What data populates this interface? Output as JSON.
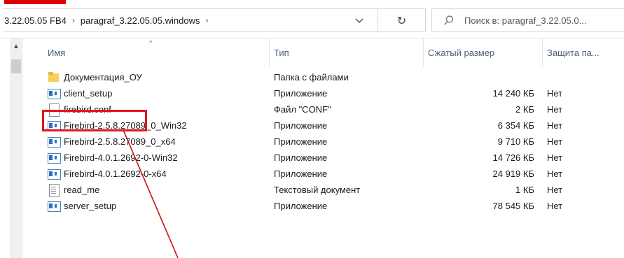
{
  "address": {
    "crumbs": [
      "3.22.05.05 FB4",
      "paragraf_3.22.05.05.windows"
    ],
    "separator": "›",
    "dropdown_glyph": "⌄",
    "refresh_glyph": "↻"
  },
  "search": {
    "placeholder": "Поиск в: paragraf_3.22.05.0..."
  },
  "columns": {
    "name": "Имя",
    "type": "Тип",
    "size": "Сжатый размер",
    "protect": "Защита па..."
  },
  "files": [
    {
      "name": "Документация_ОУ",
      "type": "Папка с файлами",
      "size": "",
      "protect": "",
      "icon": "folder-icon"
    },
    {
      "name": "client_setup",
      "type": "Приложение",
      "size": "14 240 КБ",
      "protect": "Нет",
      "icon": "app-icon"
    },
    {
      "name": "firebird.conf",
      "type": "Файл \"CONF\"",
      "size": "2 КБ",
      "protect": "Нет",
      "icon": "file-icon"
    },
    {
      "name": "Firebird-2.5.8.27089_0_Win32",
      "type": "Приложение",
      "size": "6 354 КБ",
      "protect": "Нет",
      "icon": "app-icon"
    },
    {
      "name": "Firebird-2.5.8.27089_0_x64",
      "type": "Приложение",
      "size": "9 710 КБ",
      "protect": "Нет",
      "icon": "app-icon"
    },
    {
      "name": "Firebird-4.0.1.2692-0-Win32",
      "type": "Приложение",
      "size": "14 726 КБ",
      "protect": "Нет",
      "icon": "app-icon"
    },
    {
      "name": "Firebird-4.0.1.2692-0-x64",
      "type": "Приложение",
      "size": "24 919 КБ",
      "protect": "Нет",
      "icon": "app-icon"
    },
    {
      "name": "read_me",
      "type": "Текстовый документ",
      "size": "1 КБ",
      "protect": "Нет",
      "icon": "text-icon"
    },
    {
      "name": "server_setup",
      "type": "Приложение",
      "size": "78 545 КБ",
      "protect": "Нет",
      "icon": "app-icon"
    }
  ],
  "colors": {
    "highlight": "#e0141e",
    "header_text": "#4c607a",
    "folder": "#f7cf5a",
    "app_blue": "#2f6fbf"
  }
}
